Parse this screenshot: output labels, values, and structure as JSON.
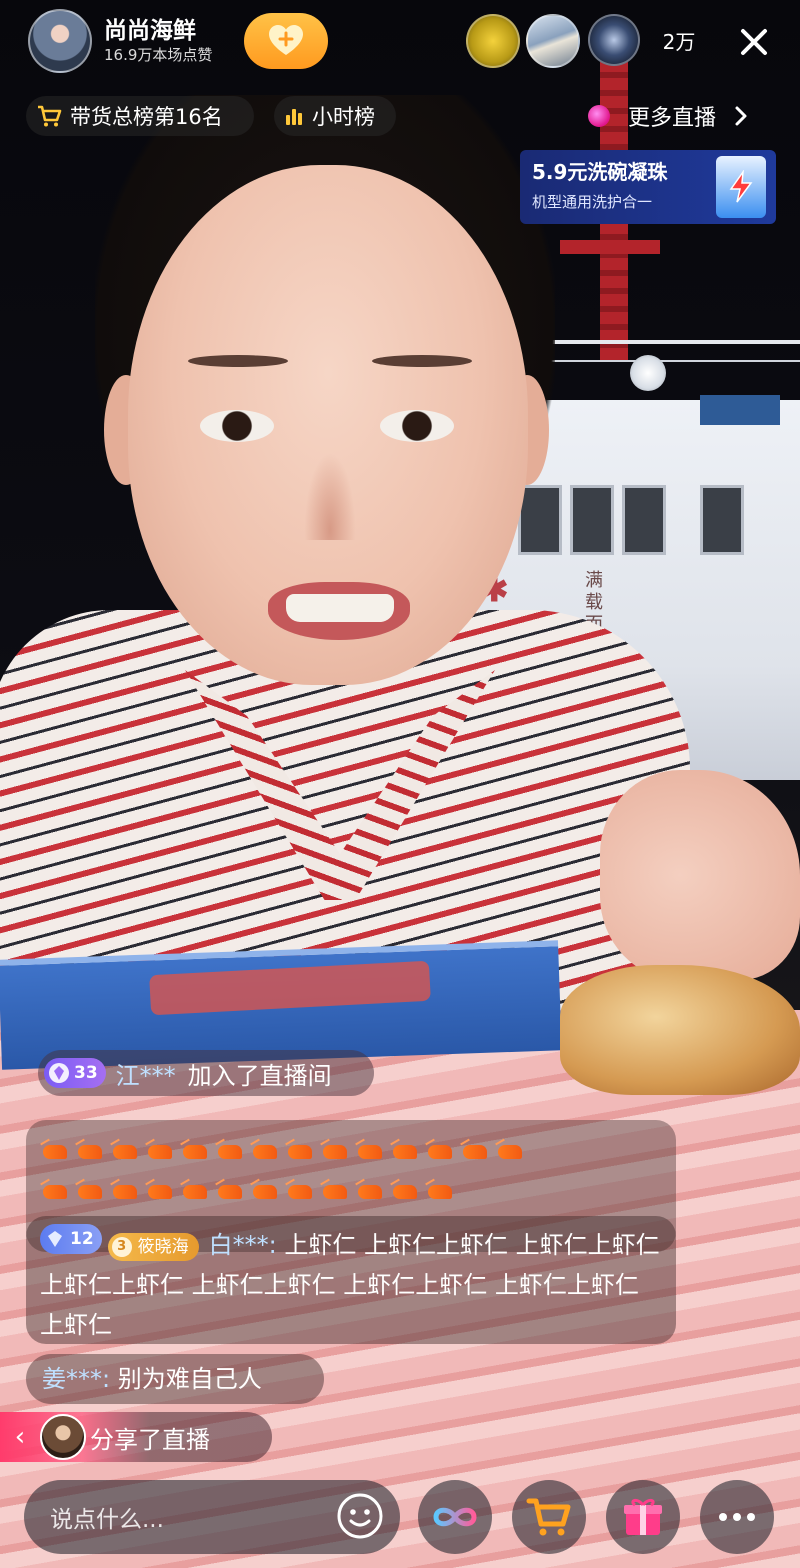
{
  "host": {
    "name": "尚尚海鲜",
    "likes": "16.9万本场点赞"
  },
  "viewers": {
    "count": "2万"
  },
  "rank": {
    "sales_rank": "带货总榜第16名",
    "hourly_rank": "小时榜"
  },
  "more_live": {
    "label": "更多直播"
  },
  "ad": {
    "title": "5.9元洗碗凝珠",
    "subtitle": "机型通用洗护合一"
  },
  "background": {
    "ship_text": "满载而归"
  },
  "chat": {
    "join": {
      "level": "33",
      "user": "江***",
      "text": "加入了直播间"
    },
    "shrimp_rows": [
      14,
      12
    ],
    "long_message": {
      "level": "12",
      "fan_level": "3",
      "fan_club": "筱晓海",
      "user": "白***:",
      "text": "上虾仁 上虾仁上虾仁 上虾仁上虾仁 上虾仁上虾仁 上虾仁上虾仁 上虾仁上虾仁 上虾仁上虾仁 上虾仁"
    },
    "short_message": {
      "user": "姜***:",
      "text": "别为难自己人"
    },
    "share": {
      "text": "分享了直播"
    }
  },
  "bottom": {
    "comment_placeholder": "说点什么..."
  },
  "colors": {
    "follow_orange": "#ff9a1f",
    "username_blue": "#bfe0ff",
    "share_pink": "#ff3c6c",
    "cart_orange": "#ffa21f",
    "gift_pink": "#ff3d8a"
  }
}
